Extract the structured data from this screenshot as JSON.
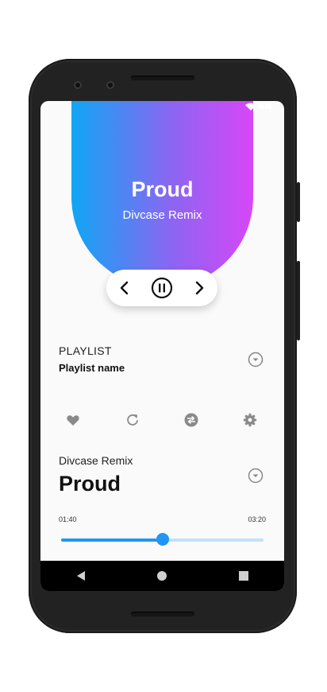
{
  "now_playing": {
    "title": "Proud",
    "artist": "Divcase Remix"
  },
  "playlist": {
    "heading": "PLAYLIST",
    "name": "Playlist name"
  },
  "track_info": {
    "artist": "Divcase Remix",
    "title": "Proud"
  },
  "progress": {
    "elapsed": "01:40",
    "total": "03:20",
    "fraction": 0.5
  },
  "icons": {
    "prev": "chevron-left-icon",
    "pause": "pause-circle-icon",
    "next": "chevron-right-icon",
    "favorite": "heart-icon",
    "repeat": "repeat-icon",
    "shuffle": "shuffle-icon",
    "settings": "gear-icon"
  },
  "colors": {
    "gradient_start": "#0fa6f5",
    "gradient_end": "#d846f8",
    "accent": "#2196f3",
    "track_bg": "#bfe2fb"
  }
}
